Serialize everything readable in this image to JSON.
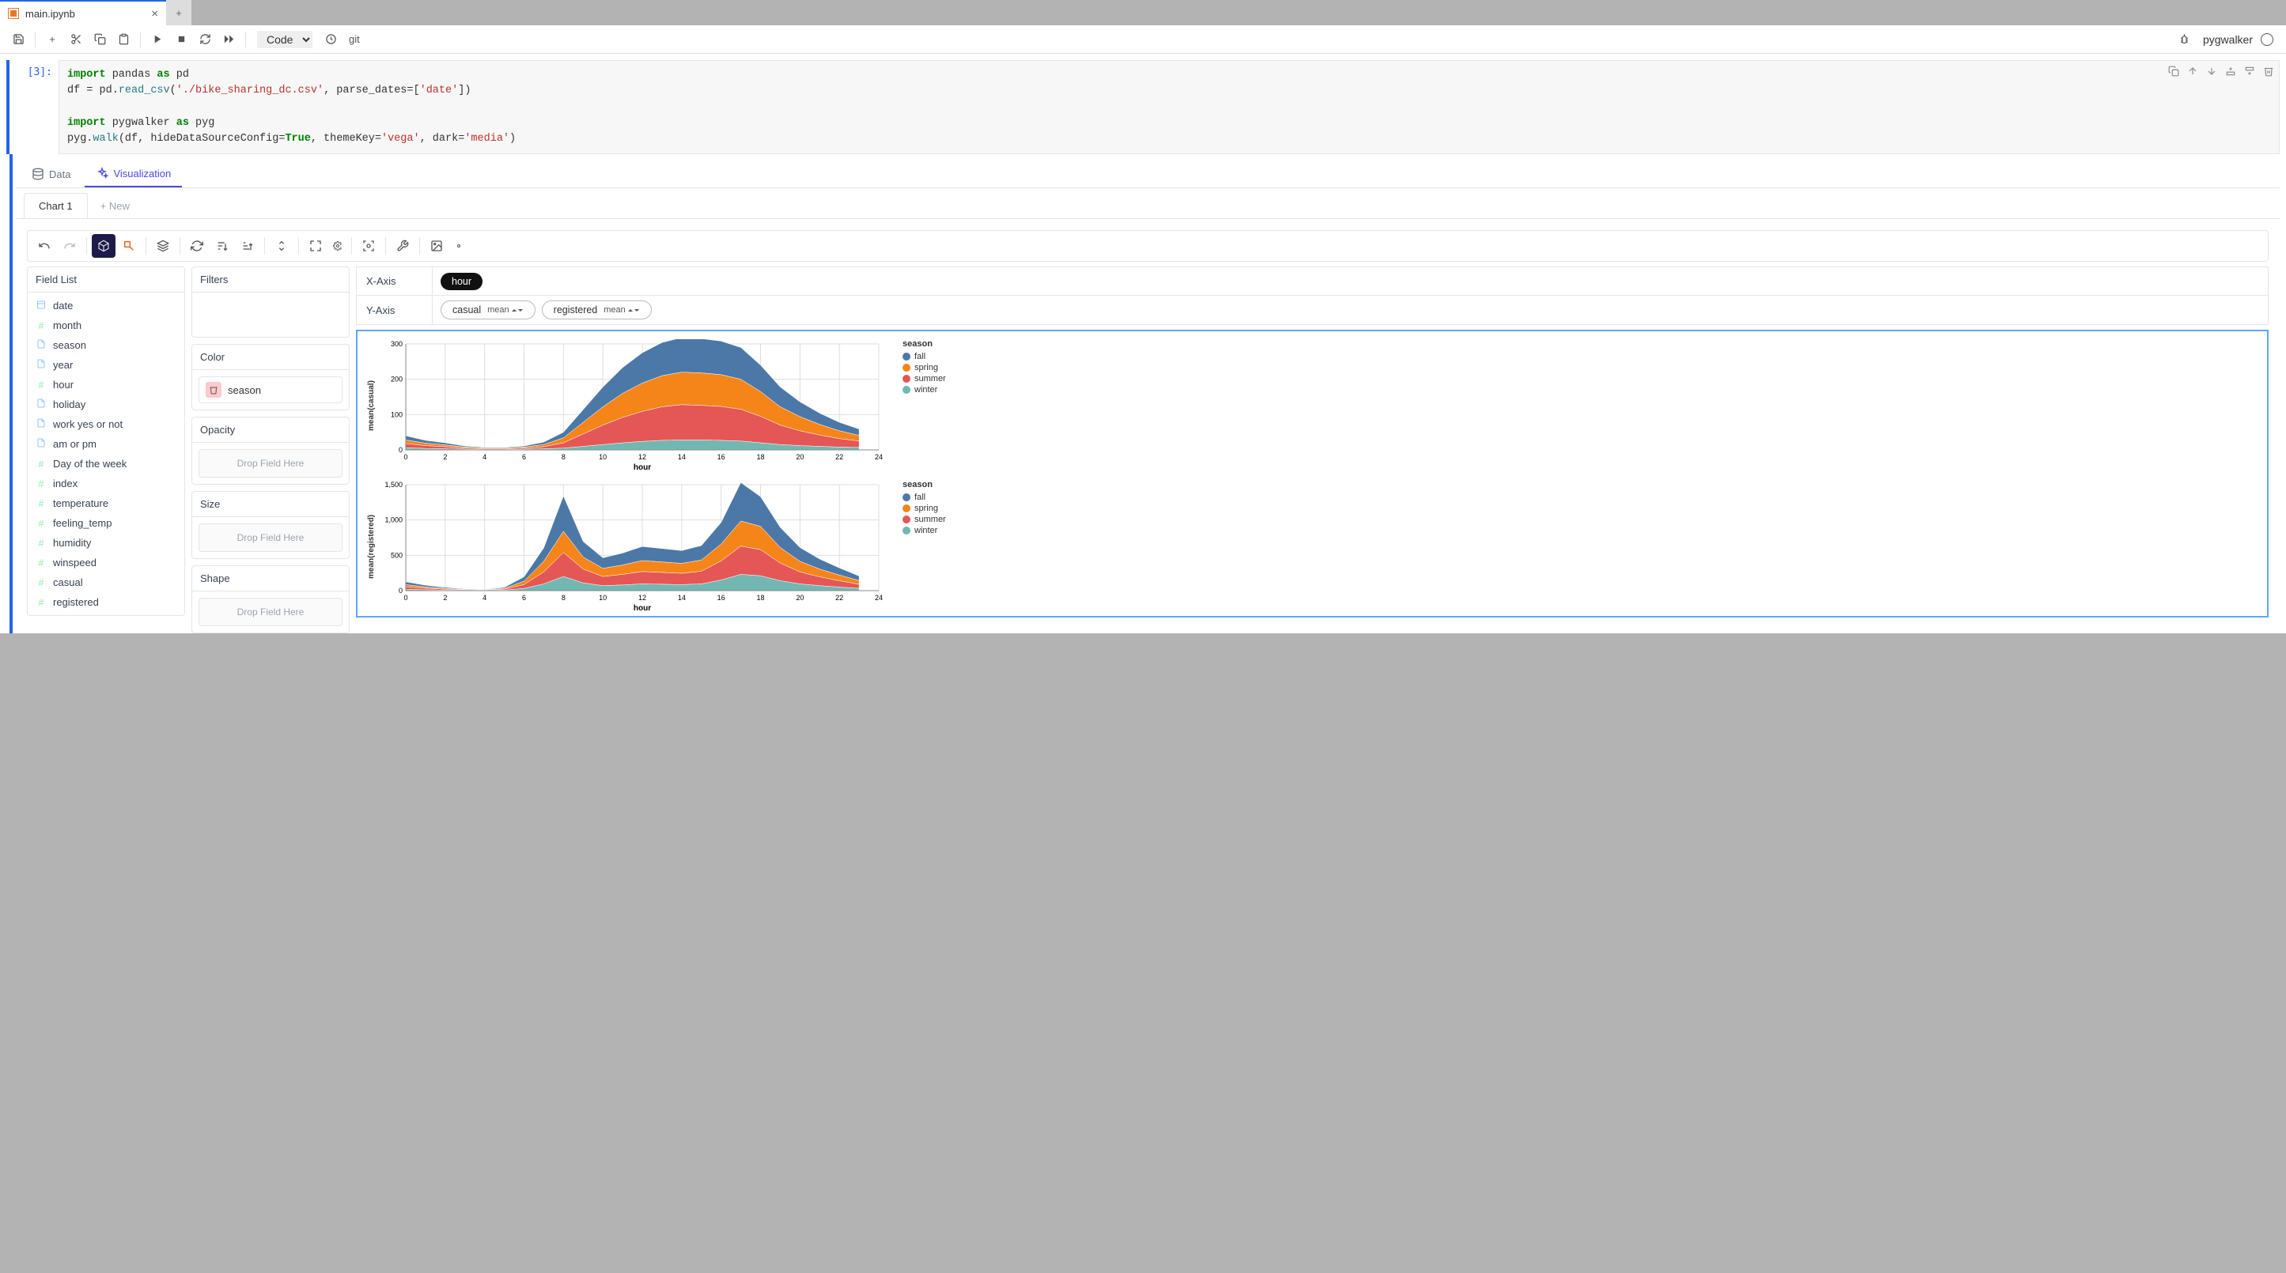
{
  "tab": {
    "title": "main.ipynb"
  },
  "toolbar": {
    "celltype": "Code",
    "git_label": "git",
    "kernel_name": "pygwalker"
  },
  "cell": {
    "prompt": "[3]:",
    "code": {
      "l1": {
        "a": "import",
        "b": " pandas ",
        "c": "as",
        "d": " pd"
      },
      "l2": {
        "a": "df = pd.",
        "b": "read_csv",
        "c": "(",
        "d": "'./bike_sharing_dc.csv'",
        "e": ", parse_dates=[",
        "f": "'date'",
        "g": "])"
      },
      "l4": {
        "a": "import",
        "b": " pygwalker ",
        "c": "as",
        "d": " pyg"
      },
      "l5": {
        "a": "pyg.",
        "b": "walk",
        "c": "(df, hideDataSourceConfig=",
        "d": "True",
        "e": ", themeKey=",
        "f": "'vega'",
        "g": ", dark=",
        "h": "'media'",
        "i": ")"
      }
    }
  },
  "pyg": {
    "tabs": {
      "data": "Data",
      "viz": "Visualization"
    },
    "subtabs": {
      "chart1": "Chart 1",
      "new": "+ New"
    },
    "panels": {
      "fieldlist_header": "Field List",
      "filters_header": "Filters",
      "color_header": "Color",
      "opacity_header": "Opacity",
      "size_header": "Size",
      "shape_header": "Shape",
      "drop_placeholder": "Drop Field Here",
      "xaxis_label": "X-Axis",
      "yaxis_label": "Y-Axis"
    },
    "color_pill": "season",
    "xaxis_pill": "hour",
    "yaxis_pills": [
      {
        "name": "casual",
        "agg": "mean"
      },
      {
        "name": "registered",
        "agg": "mean"
      }
    ],
    "fields": [
      {
        "name": "date",
        "type": "date"
      },
      {
        "name": "month",
        "type": "num"
      },
      {
        "name": "season",
        "type": "cat"
      },
      {
        "name": "year",
        "type": "cat"
      },
      {
        "name": "hour",
        "type": "num"
      },
      {
        "name": "holiday",
        "type": "cat"
      },
      {
        "name": "work yes or not",
        "type": "cat"
      },
      {
        "name": "am or pm",
        "type": "cat"
      },
      {
        "name": "Day of the week",
        "type": "num"
      },
      {
        "name": "index",
        "type": "num"
      },
      {
        "name": "temperature",
        "type": "num"
      },
      {
        "name": "feeling_temp",
        "type": "num"
      },
      {
        "name": "humidity",
        "type": "num"
      },
      {
        "name": "winspeed",
        "type": "num"
      },
      {
        "name": "casual",
        "type": "num"
      },
      {
        "name": "registered",
        "type": "num"
      }
    ]
  },
  "chart_data": [
    {
      "type": "area",
      "title": "",
      "xlabel": "hour",
      "ylabel": "mean(casual)",
      "x": [
        0,
        1,
        2,
        3,
        4,
        5,
        6,
        7,
        8,
        9,
        10,
        11,
        12,
        13,
        14,
        15,
        16,
        17,
        18,
        19,
        20,
        21,
        22,
        23
      ],
      "ylim": [
        0,
        300
      ],
      "xticks": [
        0,
        2,
        4,
        6,
        8,
        10,
        12,
        14,
        16,
        18,
        20,
        22,
        24
      ],
      "yticks": [
        0,
        100,
        200,
        300
      ],
      "legend_title": "season",
      "colors": {
        "fall": "#4c78a8",
        "spring": "#f58518",
        "summer": "#e45756",
        "winter": "#72b7b2"
      },
      "series": [
        {
          "name": "winter",
          "values": [
            6,
            4,
            3,
            2,
            1,
            1,
            2,
            3,
            5,
            10,
            15,
            20,
            24,
            27,
            28,
            28,
            27,
            25,
            20,
            15,
            12,
            10,
            8,
            7
          ]
        },
        {
          "name": "summer",
          "values": [
            12,
            8,
            6,
            3,
            2,
            2,
            3,
            6,
            15,
            35,
            55,
            72,
            85,
            95,
            100,
            98,
            96,
            90,
            75,
            55,
            42,
            32,
            24,
            18
          ]
        },
        {
          "name": "spring",
          "values": [
            10,
            7,
            5,
            3,
            2,
            2,
            3,
            6,
            14,
            33,
            52,
            68,
            80,
            88,
            92,
            92,
            90,
            85,
            70,
            52,
            40,
            30,
            22,
            16
          ]
        },
        {
          "name": "fall",
          "values": [
            12,
            8,
            6,
            3,
            2,
            2,
            3,
            7,
            16,
            36,
            56,
            73,
            86,
            94,
            98,
            97,
            95,
            90,
            75,
            56,
            42,
            32,
            24,
            18
          ]
        }
      ]
    },
    {
      "type": "area",
      "title": "",
      "xlabel": "hour",
      "ylabel": "mean(registered)",
      "x": [
        0,
        1,
        2,
        3,
        4,
        5,
        6,
        7,
        8,
        9,
        10,
        11,
        12,
        13,
        14,
        15,
        16,
        17,
        18,
        19,
        20,
        21,
        22,
        23
      ],
      "ylim": [
        0,
        1500
      ],
      "xticks": [
        0,
        2,
        4,
        6,
        8,
        10,
        12,
        14,
        16,
        18,
        20,
        22,
        24
      ],
      "yticks": [
        0,
        500,
        1000,
        1500
      ],
      "legend_title": "season",
      "colors": {
        "fall": "#4c78a8",
        "spring": "#f58518",
        "summer": "#e45756",
        "winter": "#72b7b2"
      },
      "series": [
        {
          "name": "winter",
          "values": [
            20,
            12,
            7,
            4,
            3,
            7,
            30,
            95,
            200,
            110,
            70,
            80,
            95,
            90,
            85,
            95,
            150,
            230,
            210,
            140,
            95,
            70,
            50,
            32
          ]
        },
        {
          "name": "summer",
          "values": [
            35,
            22,
            13,
            7,
            5,
            13,
            55,
            170,
            340,
            195,
            130,
            150,
            175,
            168,
            160,
            180,
            270,
            400,
            370,
            250,
            170,
            125,
            90,
            58
          ]
        },
        {
          "name": "spring",
          "values": [
            30,
            18,
            11,
            6,
            4,
            11,
            48,
            150,
            300,
            170,
            115,
            132,
            155,
            148,
            140,
            158,
            240,
            355,
            330,
            220,
            150,
            110,
            80,
            52
          ]
        },
        {
          "name": "fall",
          "values": [
            40,
            25,
            15,
            8,
            6,
            15,
            62,
            190,
            500,
            220,
            150,
            170,
            200,
            190,
            182,
            205,
            305,
            545,
            420,
            285,
            195,
            142,
            102,
            65
          ]
        }
      ]
    }
  ]
}
